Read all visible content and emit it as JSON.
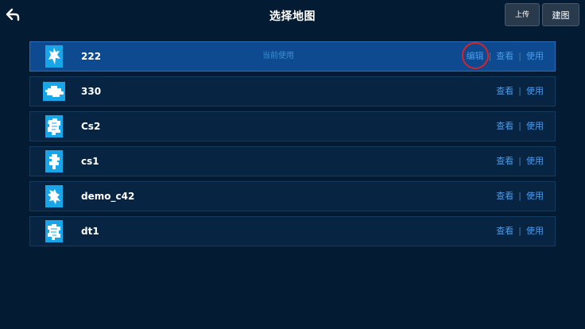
{
  "header": {
    "back_icon": "back-arrow-icon",
    "title": "选择地图",
    "upload_label": "上传",
    "build_label": "建图"
  },
  "colors": {
    "background": "#041c33",
    "row_bg": "#072443",
    "row_active_bg": "#0d4a8f",
    "link": "#4c9ae6",
    "thumb": "#19a6e8",
    "highlight_circle": "#d8232a"
  },
  "maps": [
    {
      "name": "222",
      "status": "当前使用",
      "edit": "编辑",
      "view": "查看",
      "use": "使用",
      "active": true
    },
    {
      "name": "330",
      "view": "查看",
      "use": "使用"
    },
    {
      "name": "Cs2",
      "view": "查看",
      "use": "使用"
    },
    {
      "name": "cs1",
      "view": "查看",
      "use": "使用"
    },
    {
      "name": "demo_c42",
      "view": "查看",
      "use": "使用"
    },
    {
      "name": "dt1",
      "view": "查看",
      "use": "使用"
    }
  ]
}
